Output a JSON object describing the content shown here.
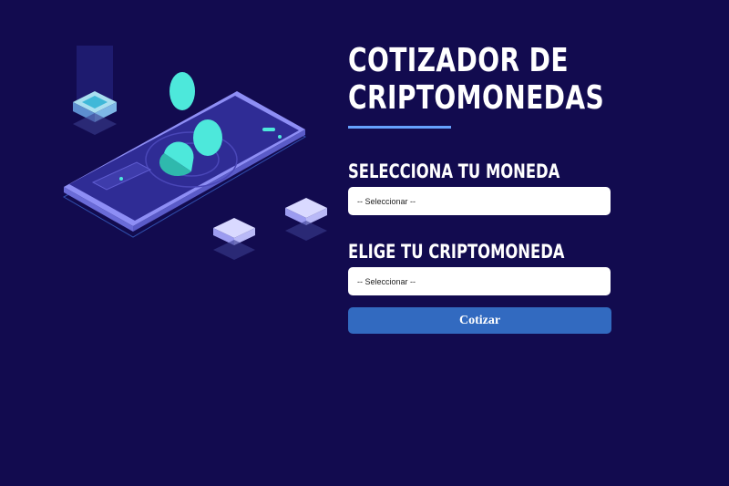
{
  "title_line1": "COTIZADOR DE",
  "title_line2": "CRIPTOMONEDAS",
  "currency": {
    "label": "SELECCIONA TU MONEDA",
    "selected": "-- Seleccionar --"
  },
  "crypto": {
    "label": "ELIGE TU CRIPTOMONEDA",
    "selected": "-- Seleccionar --"
  },
  "submit_label": "Cotizar",
  "colors": {
    "background": "#120b4f",
    "accent_underline": "#66a2fe",
    "button": "#326ac0",
    "coin": "#4de8db"
  },
  "illustration": "isometric-phone-with-coins"
}
